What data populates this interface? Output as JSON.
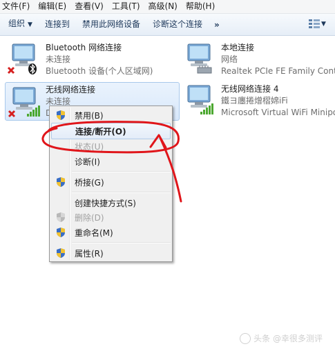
{
  "menubar": {
    "items": [
      "文件(F)",
      "编辑(E)",
      "查看(V)",
      "工具(T)",
      "高级(N)",
      "帮助(H)"
    ]
  },
  "toolbar": {
    "organize": "组织",
    "connect_to": "连接到",
    "disable_device": "禁用此网络设备",
    "diagnose": "诊断这个连接",
    "more": "»"
  },
  "connections": [
    {
      "name": "Bluetooth 网络连接",
      "status": "未连接",
      "device": "Bluetooth 设备(个人区域网)",
      "icon": "bluetooth-network-icon"
    },
    {
      "name": "本地连接",
      "status": "网络",
      "device": "Realtek PCIe FE Family Controller",
      "icon": "ethernet-network-icon"
    },
    {
      "name": "无线网络连接",
      "status": "未连接",
      "device": "D",
      "icon": "wireless-network-icon"
    },
    {
      "name": "无线网络连接 4",
      "status": "鐵ヨ廛捲熷槢婂iFi",
      "device": "Microsoft Virtual WiFi Miniport Adapter",
      "icon": "wireless-network-icon"
    }
  ],
  "context_menu": {
    "items": [
      {
        "label": "禁用(B)",
        "shield": true,
        "disabled": false,
        "bold": false
      },
      {
        "label": "连接/断开(O)",
        "shield": false,
        "disabled": false,
        "bold": true
      },
      {
        "label": "状态(U)",
        "shield": false,
        "disabled": true,
        "bold": false
      },
      {
        "label": "诊断(I)",
        "shield": false,
        "disabled": false,
        "bold": false
      },
      {
        "label": "桥接(G)",
        "shield": true,
        "disabled": false,
        "bold": false
      },
      {
        "label": "创建快捷方式(S)",
        "shield": false,
        "disabled": false,
        "bold": false
      },
      {
        "label": "删除(D)",
        "shield": true,
        "disabled": true,
        "bold": false
      },
      {
        "label": "重命名(M)",
        "shield": true,
        "disabled": false,
        "bold": false
      },
      {
        "label": "属性(R)",
        "shield": true,
        "disabled": false,
        "bold": false
      }
    ]
  },
  "watermark": "头条 @幸很多测评",
  "colors": {
    "annotation_red": "#e0151a",
    "selection_bg": "#d8e8fb",
    "disabled_x": "#d62020",
    "signal_green": "#4ca830"
  }
}
